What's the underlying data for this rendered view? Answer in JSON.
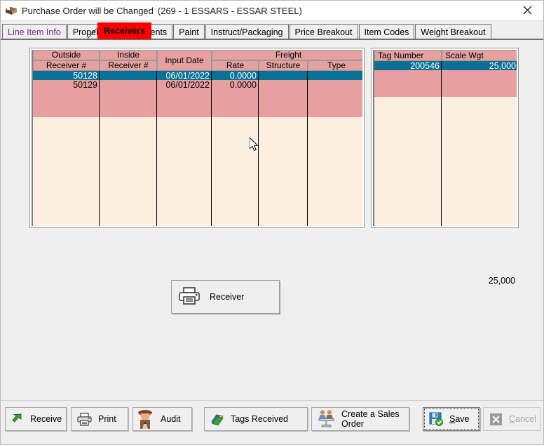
{
  "window": {
    "title": "Purchase Order will be Changed",
    "subtitle": "(269 - 1  ESSARS -  ESSAR STEEL)",
    "icon": "package-box-icon",
    "close_label": "close-icon"
  },
  "tabs": {
    "items": [
      {
        "label": "Line Item Info",
        "active": false,
        "color": "#7d2d8c"
      },
      {
        "label": "Properties",
        "active": false,
        "color": "#000000"
      },
      {
        "label": "Comments",
        "active": false,
        "color": "#000000"
      },
      {
        "label": "Paint",
        "active": false,
        "color": "#000000"
      },
      {
        "label": "Instruct/Packaging",
        "active": false,
        "color": "#000000"
      },
      {
        "label": "Price Breakout",
        "active": false,
        "color": "#000000"
      },
      {
        "label": "Item Codes",
        "active": false,
        "color": "#000000"
      },
      {
        "label": "Weight Breakout",
        "active": false,
        "color": "#000000"
      }
    ],
    "active_tab": {
      "label": "Receivers",
      "background": "#ff0000",
      "color": "#000000"
    }
  },
  "receivers_grid": {
    "group_headers": [
      {
        "label": "Outside Receiver #",
        "line1": "Outside",
        "line2": "Receiver #"
      },
      {
        "label": "Inside Receiver #",
        "line1": "Inside",
        "line2": "Receiver #"
      },
      {
        "label": "Input Date",
        "line1": "Input Date",
        "line2": ""
      },
      {
        "label": "Freight",
        "line1": "Freight",
        "line2": ""
      }
    ],
    "freight_subheaders": [
      "Rate",
      "Structure",
      "Type"
    ],
    "columns": [
      "Outside Receiver #",
      "Inside Receiver #",
      "Input Date",
      "Rate",
      "Structure",
      "Type"
    ],
    "rows": [
      {
        "selected": true,
        "outside_receiver": "50128",
        "inside_receiver": "",
        "input_date": "06/01/2022",
        "rate": "0.0000",
        "structure": "",
        "type": ""
      },
      {
        "selected": false,
        "outside_receiver": "50129",
        "inside_receiver": "",
        "input_date": "06/01/2022",
        "rate": "0.0000",
        "structure": "",
        "type": ""
      }
    ],
    "selected_row_color": "#0b7094",
    "row_color": "#e6a0a0",
    "empty_color": "#fdeee2"
  },
  "tags_grid": {
    "columns": [
      "Tag Number",
      "Scale Wgt"
    ],
    "rows": [
      {
        "selected": true,
        "tag_number": "200546",
        "scale_wgt": "25,000"
      }
    ],
    "total": "25,000"
  },
  "receiver_button": {
    "label": "Receiver",
    "icon": "printer-icon"
  },
  "footer": {
    "buttons": [
      {
        "label": "Receive",
        "icon": "green-arrow-icon",
        "disabled": false
      },
      {
        "label": "Print",
        "icon": "printer-icon",
        "disabled": false
      },
      {
        "label": "Audit",
        "icon": "detective-icon",
        "disabled": false
      },
      {
        "label": "Tags Received",
        "icon": "books-icon",
        "disabled": false
      },
      {
        "label": "Create a Sales Order",
        "line1": "Create a Sales",
        "line2": "Order",
        "icon": "sales-order-icon",
        "disabled": false
      },
      {
        "label": "Save",
        "icon": "save-disk-icon",
        "disabled": false
      },
      {
        "label": "Cancel",
        "icon": "cancel-x-icon",
        "disabled": true
      }
    ]
  }
}
